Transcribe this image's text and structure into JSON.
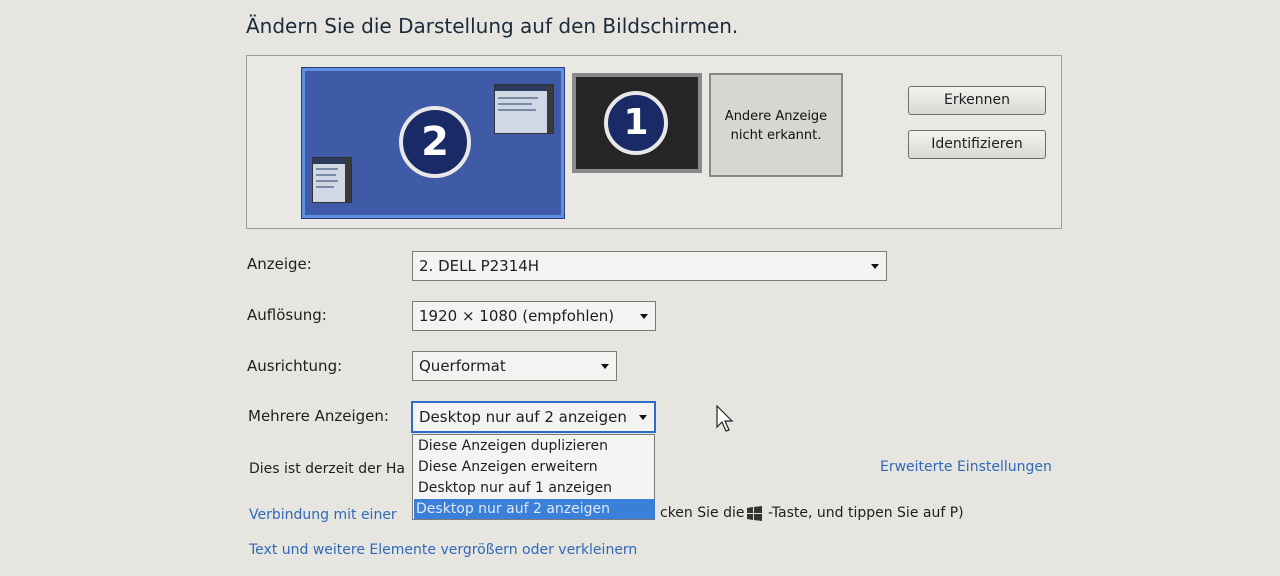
{
  "header": {
    "title": "Ändern Sie die Darstellung auf den Bildschirmen."
  },
  "monitors": [
    {
      "number": "2",
      "selected": true
    },
    {
      "number": "1",
      "selected": false
    },
    {
      "text": "Andere Anzeige nicht erkannt."
    }
  ],
  "buttons": {
    "detect": "Erkennen",
    "identify": "Identifizieren"
  },
  "settings": {
    "display": {
      "label": "Anzeige:",
      "value": "2. DELL P2314H"
    },
    "resolution": {
      "label": "Auflösung:",
      "value": "1920 × 1080 (empfohlen)"
    },
    "orientation": {
      "label": "Ausrichtung:",
      "value": "Querformat"
    },
    "multiple": {
      "label": "Mehrere Anzeigen:",
      "value": "Desktop nur auf 2 anzeigen",
      "options": [
        "Diese Anzeigen duplizieren",
        "Diese Anzeigen erweitern",
        "Desktop nur auf 1 anzeigen",
        "Desktop nur auf 2 anzeigen"
      ],
      "selected_index": 3
    }
  },
  "status_text": "Dies ist derzeit der Ha",
  "links": {
    "advanced": "Erweiterte Einstellungen",
    "projector_partial": "Verbindung mit einer",
    "enlarge_text": "Text und weitere Elemente vergrößern oder verkleinern"
  },
  "hint": {
    "before_logo": "cken Sie die",
    "after_logo": "-Taste, und tippen Sie auf P)"
  },
  "colors": {
    "selection": "#3a7fd8",
    "link": "#2f69b8",
    "monitor_selected": "#3f5aa6"
  }
}
